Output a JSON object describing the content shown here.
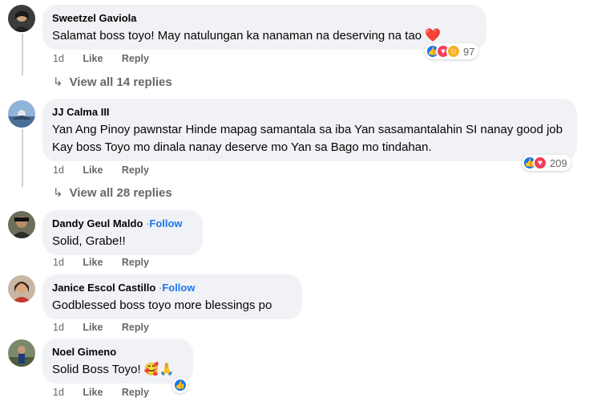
{
  "comments": [
    {
      "author": "Sweetzel Gaviola",
      "text": "Salamat boss toyo! May natulungan ka nanaman na deserving na tao",
      "emoji": "❤️",
      "time": "1d",
      "like_label": "Like",
      "reply_label": "Reply",
      "reaction_count": "97",
      "view_replies": "View all 14 replies"
    },
    {
      "author": "JJ Calma III",
      "text": "Yan Ang Pinoy pawnstar Hinde mapag samantala sa iba Yan sasamantalahin SI nanay good job Kay boss Toyo mo dinala nanay deserve mo Yan sa Bago mo tindahan.",
      "time": "1d",
      "like_label": "Like",
      "reply_label": "Reply",
      "reaction_count": "209",
      "view_replies": "View all 28 replies"
    },
    {
      "author": "Dandy Geul Maldo",
      "follow_sep": "·",
      "follow": "Follow",
      "text": "Solid, Grabe!!",
      "time": "1d",
      "like_label": "Like",
      "reply_label": "Reply"
    },
    {
      "author": "Janice Escol Castillo",
      "follow_sep": "·",
      "follow": "Follow",
      "text": "Godblessed boss toyo more blessings po",
      "time": "1d",
      "like_label": "Like",
      "reply_label": "Reply"
    },
    {
      "author": "Noel Gimeno",
      "text": "Solid Boss Toyo!",
      "emoji": "🥰🙏",
      "time": "1d",
      "like_label": "Like",
      "reply_label": "Reply"
    }
  ],
  "icons": {
    "like": "thumbs-up-icon",
    "love": "heart-icon",
    "care": "care-icon",
    "reply_arrow": "reply-arrow-icon"
  },
  "colors": {
    "bubble": "#f0f2f5",
    "link": "#1877f2",
    "muted": "#65676b"
  }
}
